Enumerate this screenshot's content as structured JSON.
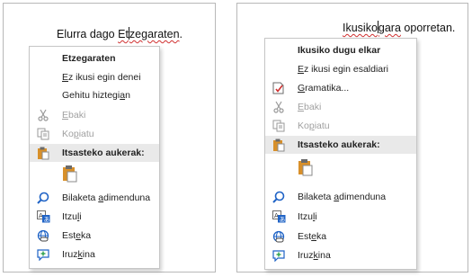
{
  "left_panel": {
    "sentence": {
      "before_caret": "Elurra dago ",
      "word_a": "Et",
      "word_b": "zegaraten",
      "after": "."
    },
    "menu": {
      "items": [
        {
          "label": "Etzegaraten",
          "bold": true
        },
        {
          "label_pre": "",
          "label_acc": "E",
          "label_post": "z ikusi egin denei"
        },
        {
          "label_pre": "Gehitu hiztegi",
          "label_acc": "a",
          "label_post": "n"
        },
        {
          "icon": "scissors-icon",
          "label_pre": "",
          "label_acc": "E",
          "label_post": "baki",
          "disabled": true
        },
        {
          "icon": "copy-icon",
          "label_pre": "Ko",
          "label_acc": "p",
          "label_post": "iatu",
          "disabled": true
        },
        {
          "icon": "clipboard-icon",
          "label": "Itsasteko aukerak:",
          "bold": true,
          "head": true
        },
        {
          "icon": "paste-option-icon"
        },
        {
          "icon": "smart-lookup-icon",
          "label_pre": "Bilaketa ",
          "label_acc": "a",
          "label_post": "dimenduna"
        },
        {
          "icon": "translate-icon",
          "label_pre": "Itzu",
          "label_acc": "l",
          "label_post": "i"
        },
        {
          "icon": "link-icon",
          "label_pre": "Est",
          "label_acc": "e",
          "label_post": "ka"
        },
        {
          "icon": "comment-icon",
          "label_pre": "Iruz",
          "label_acc": "k",
          "label_post": "ina"
        }
      ]
    }
  },
  "right_panel": {
    "sentence": {
      "word_a": "Ikusiko",
      "word_b": "gara",
      "after": " oporretan."
    },
    "menu": {
      "items": [
        {
          "label": "Ikusiko dugu elkar",
          "bold": true
        },
        {
          "label_pre": "",
          "label_acc": "E",
          "label_post": "z ikusi egin esaldiari"
        },
        {
          "icon": "grammar-icon",
          "label_pre": "",
          "label_acc": "G",
          "label_post": "ramatika..."
        },
        {
          "icon": "scissors-icon",
          "label_pre": "",
          "label_acc": "E",
          "label_post": "baki",
          "disabled": true
        },
        {
          "icon": "copy-icon",
          "label_pre": "Ko",
          "label_acc": "p",
          "label_post": "iatu",
          "disabled": true
        },
        {
          "icon": "clipboard-icon",
          "label": "Itsasteko aukerak:",
          "bold": true,
          "head": true
        },
        {
          "icon": "paste-option-icon"
        },
        {
          "icon": "smart-lookup-icon",
          "label_pre": "Bilaketa ",
          "label_acc": "a",
          "label_post": "dimenduna"
        },
        {
          "icon": "translate-icon",
          "label_pre": "Itzu",
          "label_acc": "l",
          "label_post": "i"
        },
        {
          "icon": "link-icon",
          "label_pre": "Est",
          "label_acc": "e",
          "label_post": "ka"
        },
        {
          "icon": "comment-icon",
          "label_pre": "Iruz",
          "label_acc": "k",
          "label_post": "ina"
        }
      ]
    }
  },
  "colors": {
    "squiggle": "#d03030",
    "icon_blue": "#1f63c6",
    "clipboard_orange": "#d8902a",
    "header_gray": "#e9e9e9"
  }
}
